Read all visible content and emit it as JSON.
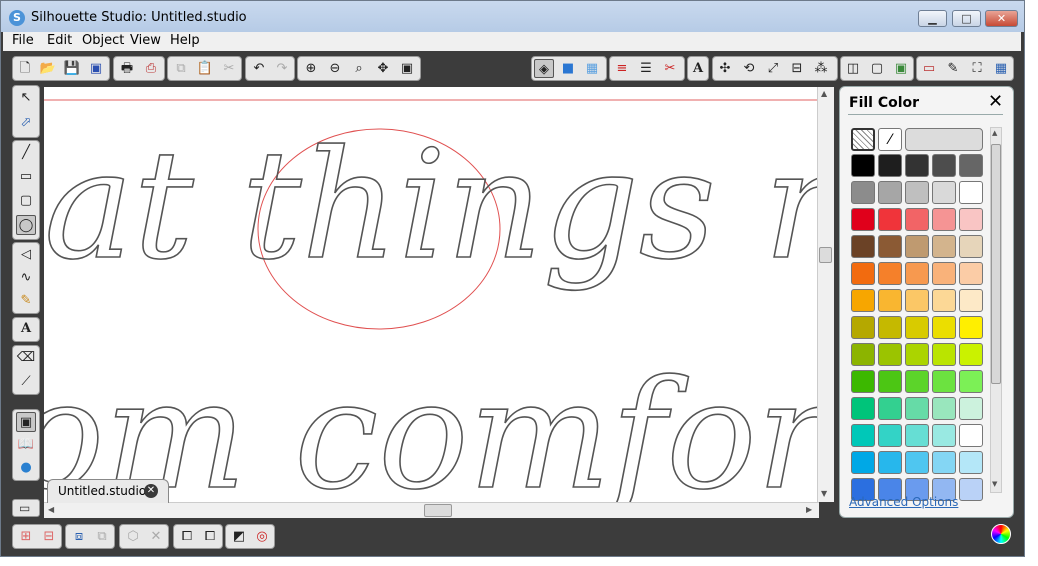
{
  "window": {
    "title": "Silhouette Studio: Untitled.studio",
    "minimize_label": "▭",
    "maximize_label": "□",
    "close_label": "✕"
  },
  "menu": {
    "items": [
      "File",
      "Edit",
      "Object",
      "View",
      "Help"
    ]
  },
  "document_tab": {
    "label": "Untitled.studio",
    "close_label": "✕"
  },
  "canvas": {
    "line1_text": "at things n",
    "line2_text": "om comfort"
  },
  "fill_panel": {
    "title": "Fill Color",
    "close_label": "✕",
    "advanced_link": "Advanced Options",
    "swatches": [
      [
        "#000000",
        "#1e1e1e",
        "#333333",
        "#4d4d4d",
        "#666666"
      ],
      [
        "#8c8c8c",
        "#a6a6a6",
        "#bfbfbf",
        "#d9d9d9",
        "#ffffff"
      ],
      [
        "#e0001b",
        "#f0343a",
        "#f26466",
        "#f59494",
        "#f9c5c4"
      ],
      [
        "#6b4226",
        "#8b5a34",
        "#bf9a70",
        "#d3b48d",
        "#e6d5ba"
      ],
      [
        "#f26b0f",
        "#f5802a",
        "#f7994f",
        "#f9b27a",
        "#fbcca6"
      ],
      [
        "#f7a600",
        "#f9b630",
        "#fbc766",
        "#fcd896",
        "#fde9c7"
      ],
      [
        "#b5a800",
        "#c5b900",
        "#d8cb00",
        "#ebde00",
        "#ffef00"
      ],
      [
        "#8cb400",
        "#9bc400",
        "#abd400",
        "#bae400",
        "#caf200"
      ],
      [
        "#3cb800",
        "#4cc614",
        "#5cd42a",
        "#6ce240",
        "#7cf056"
      ],
      [
        "#00c47a",
        "#33d090",
        "#66dba7",
        "#99e6bd",
        "#ccf2dd"
      ],
      [
        "#00c8b8",
        "#33d3c6",
        "#66ded4",
        "#99e9e2",
        "#ffffff"
      ],
      [
        "#00a8e6",
        "#27b7ec",
        "#4fc6f0",
        "#84d6f4",
        "#b4e7f8"
      ],
      [
        "#2b6fe0",
        "#4a85e8",
        "#6a9bee",
        "#92b7f2",
        "#bad2f7"
      ]
    ]
  },
  "toolbar_icons": {
    "new": "new-document-icon",
    "open": "open-folder-icon",
    "save": "save-icon",
    "print": "print-icon",
    "undo": "undo-icon",
    "redo": "redo-icon",
    "zoom_in": "zoom-in-icon",
    "zoom_out": "zoom-out-icon",
    "text": "text-tool-icon"
  }
}
